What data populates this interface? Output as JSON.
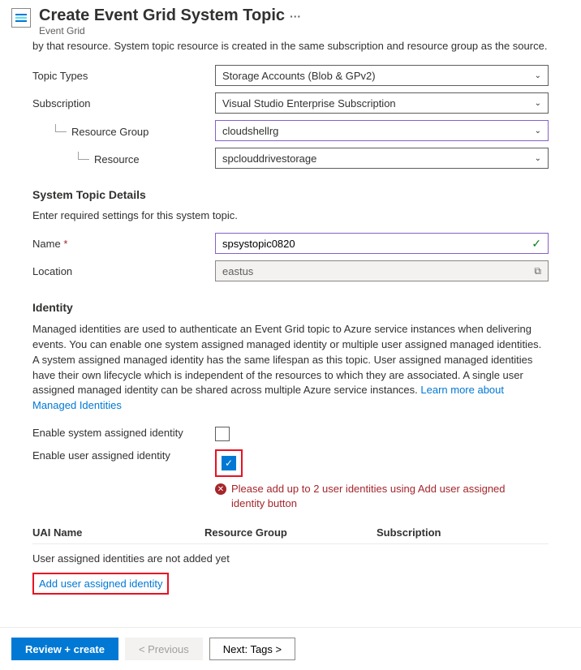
{
  "header": {
    "title": "Create Event Grid System Topic",
    "subtitle": "Event Grid"
  },
  "intro": "by that resource. System topic resource is created in the same subscription and resource group as the source.",
  "fields": {
    "topic_types": {
      "label": "Topic Types",
      "value": "Storage Accounts (Blob & GPv2)"
    },
    "subscription": {
      "label": "Subscription",
      "value": "Visual Studio Enterprise Subscription"
    },
    "resource_group": {
      "label": "Resource Group",
      "value": "cloudshellrg"
    },
    "resource": {
      "label": "Resource",
      "value": "spclouddrivestorage"
    }
  },
  "system_topic": {
    "heading": "System Topic Details",
    "sub": "Enter required settings for this system topic.",
    "name_label": "Name",
    "name_value": "spsystopic0820",
    "location_label": "Location",
    "location_value": "eastus"
  },
  "identity": {
    "heading": "Identity",
    "text": "Managed identities are used to authenticate an Event Grid topic to Azure service instances when delivering events. You can enable one system assigned managed identity or multiple user assigned managed identities. A system assigned managed identity has the same lifespan as this topic. User assigned managed identities have their own lifecycle which is independent of the resources to which they are associated. A single user assigned managed identity can be shared across multiple Azure service instances. ",
    "link": "Learn more about Managed Identities",
    "system_label": "Enable system assigned identity",
    "user_label": "Enable user assigned identity",
    "error": "Please add up to 2 user identities using Add user assigned identity button",
    "table": {
      "col1": "UAI Name",
      "col2": "Resource Group",
      "col3": "Subscription",
      "empty": "User assigned identities are not added yet"
    },
    "add_link": "Add user assigned identity"
  },
  "footer": {
    "review": "Review + create",
    "previous": "< Previous",
    "next": "Next: Tags >"
  }
}
